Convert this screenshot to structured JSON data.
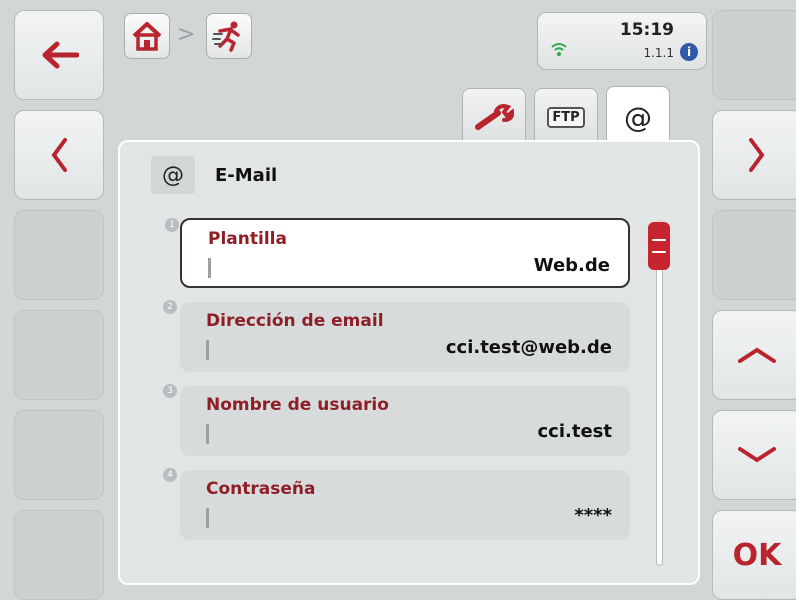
{
  "status": {
    "time": "15:19",
    "version": "1.1.1",
    "info_glyph": "i"
  },
  "breadcrumb": {
    "separator": ">"
  },
  "tabs": [
    {
      "icon": "wrench-icon"
    },
    {
      "label": "FTP"
    },
    {
      "label": "@"
    }
  ],
  "panel": {
    "icon_glyph": "@",
    "title": "E-Mail"
  },
  "fields": [
    {
      "index": "1",
      "label": "Plantilla",
      "value": "Web.de"
    },
    {
      "index": "2",
      "label": "Dirección de email",
      "value": "cci.test@web.de"
    },
    {
      "index": "3",
      "label": "Nombre de usuario",
      "value": "cci.test"
    },
    {
      "index": "4",
      "label": "Contraseña",
      "value": "****"
    }
  ],
  "softkeys": {
    "ok_label": "OK"
  },
  "colors": {
    "accent": "#b8252e",
    "background": "#d2d6d7",
    "panel": "#e2e5e6"
  }
}
